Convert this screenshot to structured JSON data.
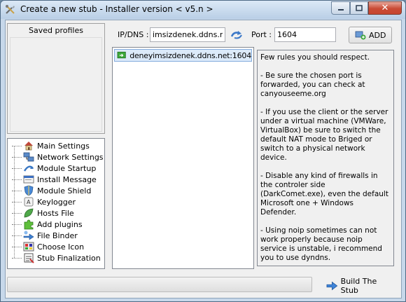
{
  "window": {
    "title": "Create a new stub - Installer version < v5.n >"
  },
  "saved_profiles": {
    "header": "Saved profiles"
  },
  "nav": {
    "items": [
      {
        "label": "Main Settings",
        "icon": "house-icon"
      },
      {
        "label": "Network Settings",
        "icon": "network-icon"
      },
      {
        "label": "Module Startup",
        "icon": "startup-icon"
      },
      {
        "label": "Install Message",
        "icon": "message-icon"
      },
      {
        "label": "Module Shield",
        "icon": "shield-icon"
      },
      {
        "label": "Keylogger",
        "icon": "keylogger-icon"
      },
      {
        "label": "Hosts File",
        "icon": "leaf-icon"
      },
      {
        "label": "Add plugins",
        "icon": "puzzle-icon"
      },
      {
        "label": "File Binder",
        "icon": "binder-icon"
      },
      {
        "label": "Choose Icon",
        "icon": "palette-icon"
      },
      {
        "label": "Stub Finalization",
        "icon": "finalization-icon"
      }
    ]
  },
  "network": {
    "ip_label": "IP/DNS :",
    "ip_value": "imsizdenek.ddns.net",
    "port_label": "Port :",
    "port_value": "1604",
    "add_label": "ADD"
  },
  "dns_list": {
    "items": [
      "deneyimsizdenek.ddns.net:1604"
    ]
  },
  "rules_text": "Few rules you should respect.\n\n- Be sure the chosen port is forwarded, you can check at canyouseeme.org\n\n- If you use the client or the server under a virtual machine (VMWare, VirtualBox) be sure to switch the default NAT mode to Briged or switch to a physical network device.\n\n- Disable any kind of firewalls in the controler side (DarkComet.exe), even the default Microsoft one + Windows Defender.\n\n- Using noip sometimes can not work properly because noip service is unstable, i recommend you to use dyndns.",
  "footer": {
    "build_label": "Build The Stub"
  }
}
